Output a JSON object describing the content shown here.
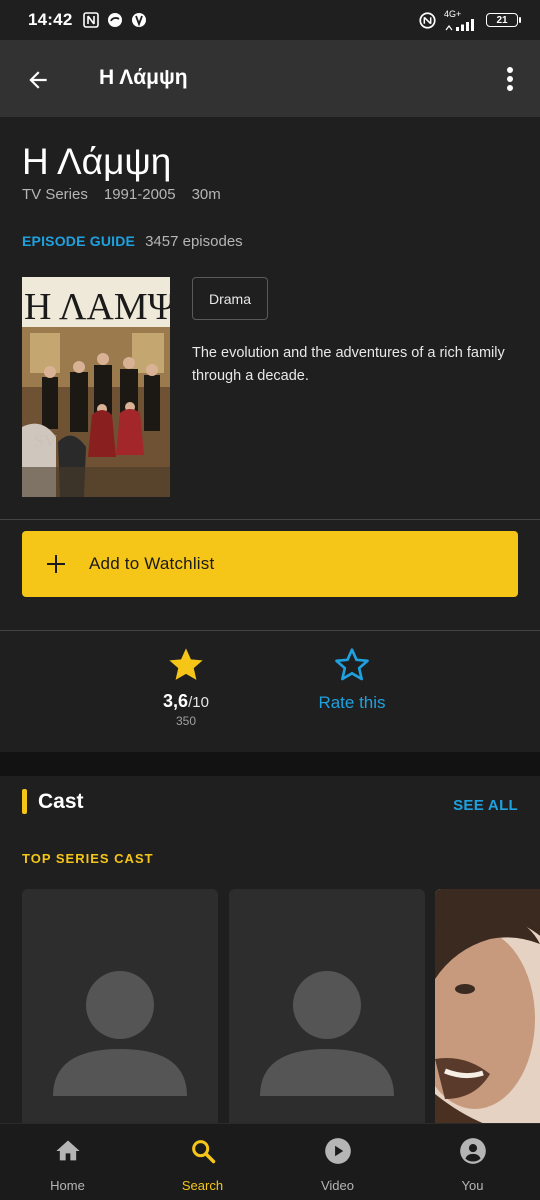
{
  "status_bar": {
    "time": "14:42",
    "network": "4G+",
    "battery": "21"
  },
  "app_bar": {
    "title": "Η Λάμψη"
  },
  "title": {
    "name": "Η Λάμψη",
    "type": "TV Series",
    "years": "1991-2005",
    "runtime": "30m"
  },
  "episodes": {
    "guide_label": "EPISODE GUIDE",
    "count": "3457 episodes"
  },
  "poster": {
    "title_text": "Η ΛΑΜΨΗ"
  },
  "genre": "Drama",
  "plot": "The evolution and the adventures of a rich family through a decade.",
  "watchlist": {
    "label": "Add to Watchlist"
  },
  "rating": {
    "value": "3,6",
    "out_of": "/10",
    "count": "350",
    "rate_label": "Rate this"
  },
  "cast": {
    "title": "Cast",
    "see_all": "SEE ALL",
    "subheading": "TOP SERIES CAST"
  },
  "bottom_nav": {
    "items": [
      {
        "label": "Home",
        "icon": "home-icon"
      },
      {
        "label": "Search",
        "icon": "search-icon",
        "active": true
      },
      {
        "label": "Video",
        "icon": "play-circle-icon"
      },
      {
        "label": "You",
        "icon": "account-icon"
      }
    ]
  },
  "colors": {
    "accent": "#f5c518",
    "link": "#1fa1e0",
    "background": "#1f1f1f",
    "app_bar": "#323232"
  }
}
